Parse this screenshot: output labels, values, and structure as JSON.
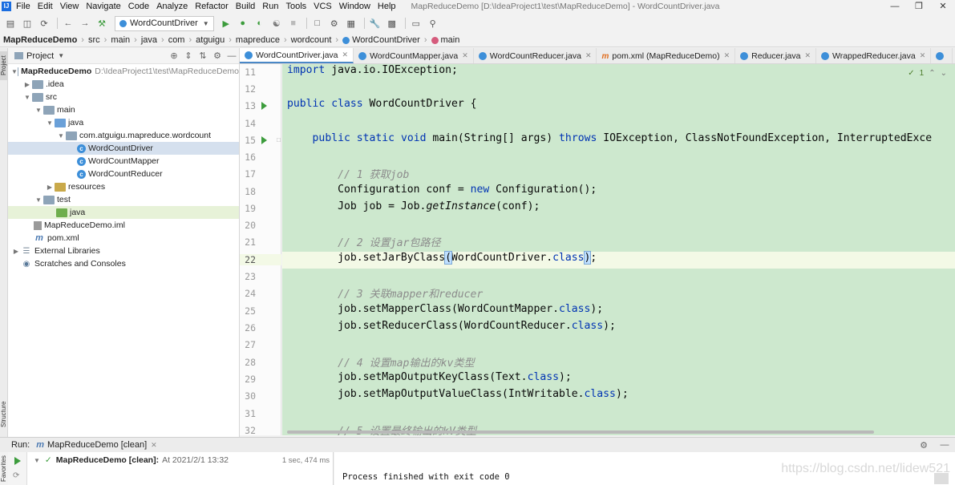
{
  "window": {
    "title": "MapReduceDemo [D:\\IdeaProject1\\test\\MapReduceDemo] - WordCountDriver.java"
  },
  "menu": [
    "File",
    "Edit",
    "View",
    "Navigate",
    "Code",
    "Analyze",
    "Refactor",
    "Build",
    "Run",
    "Tools",
    "VCS",
    "Window",
    "Help"
  ],
  "toolbar": {
    "run_config": "WordCountDriver"
  },
  "breadcrumb": [
    "MapReduceDemo",
    "src",
    "main",
    "java",
    "com",
    "atguigu",
    "mapreduce",
    "wordcount",
    "WordCountDriver",
    "main"
  ],
  "left_strip": {
    "project_label": "Project",
    "structure_label": "Structure",
    "favorites_label": "Favorites"
  },
  "project_panel": {
    "title": "Project",
    "tree": [
      {
        "label": "MapReduceDemo",
        "path": "D:\\IdeaProject1\\test\\MapReduceDemo"
      },
      {
        "label": ".idea"
      },
      {
        "label": "src"
      },
      {
        "label": "main"
      },
      {
        "label": "java"
      },
      {
        "label": "com.atguigu.mapreduce.wordcount"
      },
      {
        "label": "WordCountDriver"
      },
      {
        "label": "WordCountMapper"
      },
      {
        "label": "WordCountReducer"
      },
      {
        "label": "resources"
      },
      {
        "label": "test"
      },
      {
        "label": "java"
      },
      {
        "label": "MapReduceDemo.iml"
      },
      {
        "label": "pom.xml"
      },
      {
        "label": "External Libraries"
      },
      {
        "label": "Scratches and Consoles"
      }
    ]
  },
  "editor_tabs": [
    {
      "label": "WordCountDriver.java",
      "active": true
    },
    {
      "label": "WordCountMapper.java"
    },
    {
      "label": "WordCountReducer.java"
    },
    {
      "label": "pom.xml (MapReduceDemo)"
    },
    {
      "label": "Reducer.java"
    },
    {
      "label": "WrappedReducer.java"
    }
  ],
  "editor": {
    "inspection_count": "1",
    "current_line": 22,
    "lines": [
      {
        "n": 11,
        "text": "import java.io.IOException;"
      },
      {
        "n": 12,
        "text": ""
      },
      {
        "n": 13,
        "text": "public class WordCountDriver {"
      },
      {
        "n": 14,
        "text": ""
      },
      {
        "n": 15,
        "text": "    public static void main(String[] args) throws IOException, ClassNotFoundException, InterruptedExce"
      },
      {
        "n": 16,
        "text": ""
      },
      {
        "n": 17,
        "text": "        // 1 获取job"
      },
      {
        "n": 18,
        "text": "        Configuration conf = new Configuration();"
      },
      {
        "n": 19,
        "text": "        Job job = Job.getInstance(conf);"
      },
      {
        "n": 20,
        "text": ""
      },
      {
        "n": 21,
        "text": "        // 2 设置jar包路径"
      },
      {
        "n": 22,
        "text": "        job.setJarByClass(WordCountDriver.class);"
      },
      {
        "n": 23,
        "text": ""
      },
      {
        "n": 24,
        "text": "        // 3 关联mapper和reducer"
      },
      {
        "n": 25,
        "text": "        job.setMapperClass(WordCountMapper.class);"
      },
      {
        "n": 26,
        "text": "        job.setReducerClass(WordCountReducer.class);"
      },
      {
        "n": 27,
        "text": ""
      },
      {
        "n": 28,
        "text": "        // 4 设置map输出的kv类型"
      },
      {
        "n": 29,
        "text": "        job.setMapOutputKeyClass(Text.class);"
      },
      {
        "n": 30,
        "text": "        job.setMapOutputValueClass(IntWritable.class);"
      },
      {
        "n": 31,
        "text": ""
      },
      {
        "n": 32,
        "text": "        // 5 设置最终输出的kV类型"
      }
    ]
  },
  "run_panel": {
    "label": "Run:",
    "tab": "MapReduceDemo [clean]",
    "entry": "MapReduceDemo [clean]:",
    "entry_time": "At 2021/2/1 13:32",
    "duration": "1 sec, 474 ms",
    "output": "Process finished with exit code 0"
  },
  "watermark": "https://blog.csdn.net/lidew521"
}
